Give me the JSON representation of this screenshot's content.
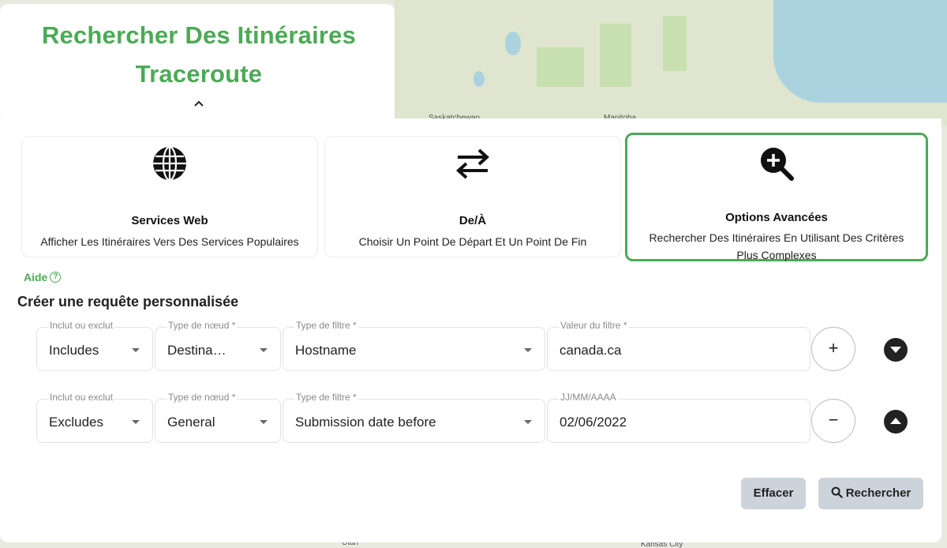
{
  "header": {
    "title_line1": "Rechercher Des Itinéraires",
    "title_line2": "Traceroute"
  },
  "map": {
    "labels": [
      "Saskatchewan",
      "Manitoba",
      "Utah",
      "Kansas City"
    ]
  },
  "modes": [
    {
      "title": "Services Web",
      "desc": "Afficher Les Itinéraires Vers Des Services Populaires",
      "icon": "globe-icon"
    },
    {
      "title": "De/À",
      "desc": "Choisir Un Point De Départ Et Un Point De Fin",
      "icon": "swap-arrows-icon"
    },
    {
      "title": "Options Avancées",
      "desc": "Rechercher Des Itinéraires En Utilisant Des Critères Plus Complexes",
      "icon": "zoom-in-icon",
      "active": true
    }
  ],
  "help": {
    "label": "Aide",
    "icon": "help-circle-icon"
  },
  "query": {
    "title": "Créer une requête personnalisée",
    "rows": [
      {
        "include_label": "Inclut ou exclut",
        "include_value": "Includes",
        "node_label": "Type de nœud *",
        "node_value": "Destina…",
        "filter_label": "Type de filtre *",
        "filter_value": "Hostname",
        "value_label": "Valeur du filtre *",
        "value_value": "canada.ca",
        "action": "+"
      },
      {
        "include_label": "Inclut ou exclut",
        "include_value": "Excludes",
        "node_label": "Type de nœud *",
        "node_value": "General",
        "filter_label": "Type de filtre *",
        "filter_value": "Submission date before",
        "value_label": "JJ/MM/AAAA",
        "value_value": "02/06/2022",
        "action": "−"
      }
    ]
  },
  "actions": {
    "clear_label": "Effacer",
    "search_label": "Rechercher"
  },
  "colors": {
    "accent": "#4caa55",
    "button_bg": "#cdd3da",
    "map_water": "#aad3df"
  }
}
